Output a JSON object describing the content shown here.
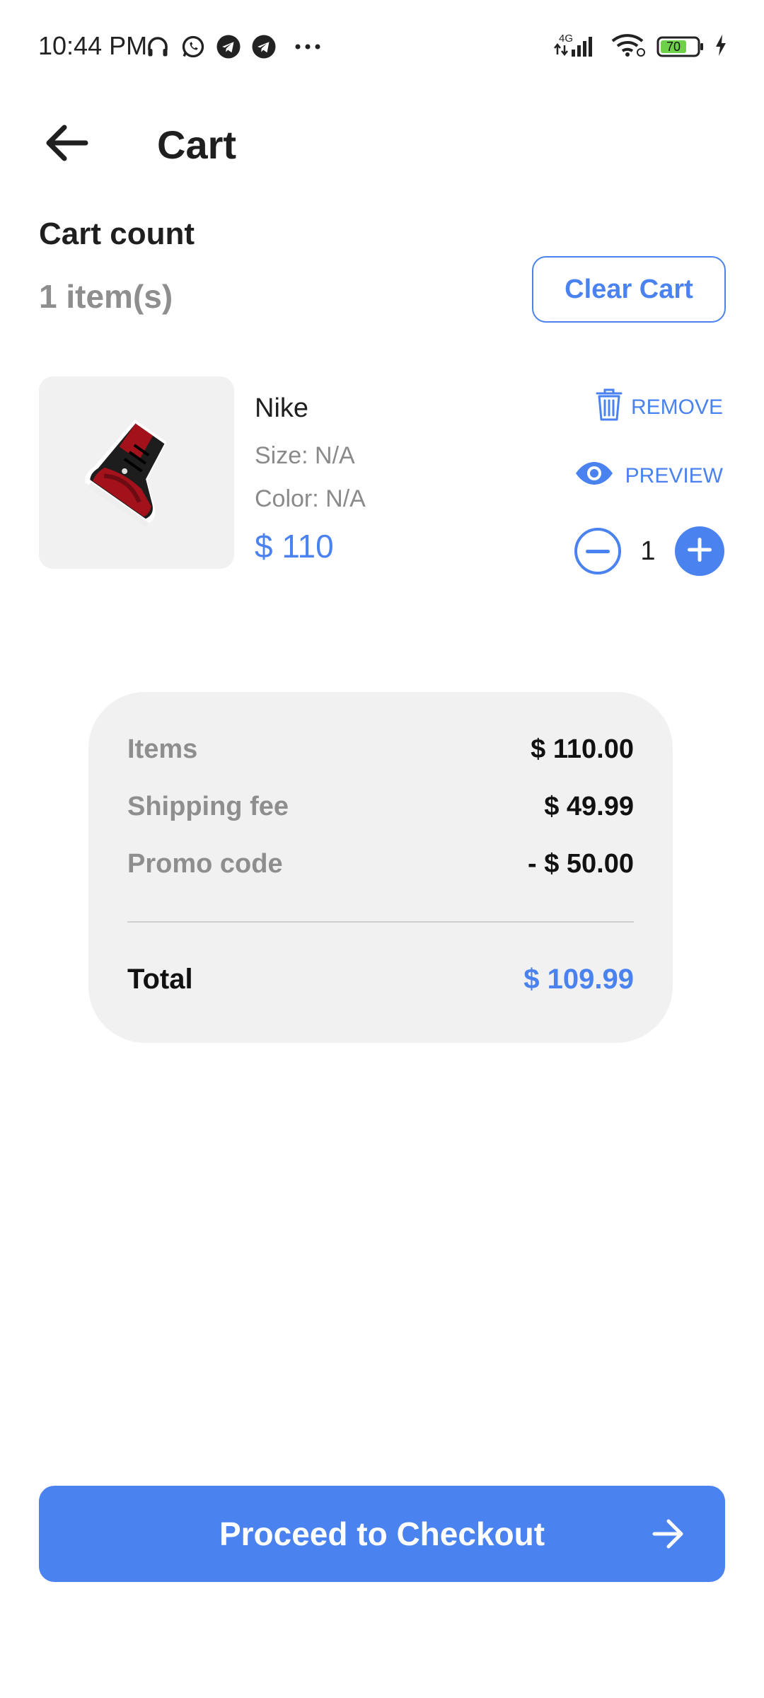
{
  "status_bar": {
    "time": "10:44 PM",
    "network": "4G",
    "battery": "70",
    "icons": [
      "headphones-icon",
      "whatsapp-icon",
      "telegram-icon",
      "telegram-icon",
      "more-dots-icon",
      "signal-icon",
      "wifi-icon",
      "battery-icon",
      "charging-icon"
    ]
  },
  "header": {
    "title": "Cart",
    "back_icon": "arrow-left-icon"
  },
  "cart_count": {
    "label": "Cart count",
    "value": "1 item(s)",
    "clear_button": "Clear Cart"
  },
  "item": {
    "name": "Nike",
    "size": "Size: N/A",
    "color": "Color: N/A",
    "price": "$ 110",
    "remove_label": "REMOVE",
    "preview_label": "PREVIEW",
    "quantity": "1"
  },
  "summary": {
    "items_label": "Items",
    "items_value": "$ 110.00",
    "shipping_label": "Shipping fee",
    "shipping_value": "$ 49.99",
    "promo_label": "Promo code",
    "promo_value": "- $ 50.00",
    "total_label": "Total",
    "total_value": "$ 109.99"
  },
  "checkout": {
    "label": "Proceed to Checkout"
  },
  "colors": {
    "accent": "#4a82f0",
    "card_bg": "#f1f1f1",
    "muted_text": "#8e8e8e"
  }
}
